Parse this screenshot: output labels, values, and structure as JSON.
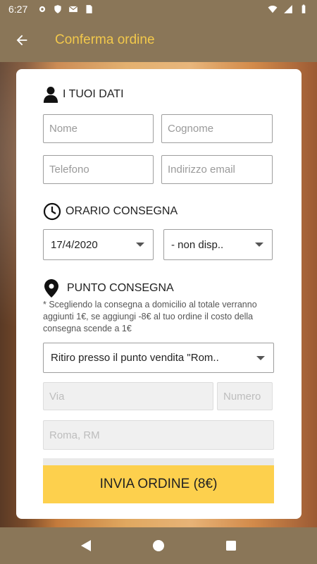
{
  "status_bar": {
    "time": "6:27"
  },
  "app_bar": {
    "title": "Conferma ordine"
  },
  "sections": {
    "user_data_title": "I TUOI DATI",
    "delivery_time_title": "ORARIO CONSEGNA",
    "delivery_point_title": "PUNTO CONSEGNA"
  },
  "fields": {
    "name_placeholder": "Nome",
    "surname_placeholder": "Cognome",
    "phone_placeholder": "Telefono",
    "email_placeholder": "Indirizzo email",
    "street_placeholder": "Via",
    "number_placeholder": "Numero",
    "city_value": "Roma, RM"
  },
  "selects": {
    "date_value": "17/4/2020",
    "time_value": "- non disp..",
    "delivery_point_value": "Ritiro presso il punto vendita \"Rom.."
  },
  "note": "* Scegliendo la consegna a domicilio al totale verranno aggiunti 1€, se aggiungi -8€ al tuo ordine il costo della consegna scende a 1€",
  "submit": {
    "label": "INVIA ORDINE (8€)"
  },
  "colors": {
    "accent": "#f2c84b",
    "button": "#fdd04d",
    "bar": "#8a7658"
  },
  "icons": [
    "settings-icon",
    "shield-icon",
    "gmail-icon",
    "sd-card-icon",
    "wifi-icon",
    "signal-icon",
    "battery-icon",
    "back-arrow-icon",
    "person-icon",
    "clock-icon",
    "location-pin-icon"
  ]
}
